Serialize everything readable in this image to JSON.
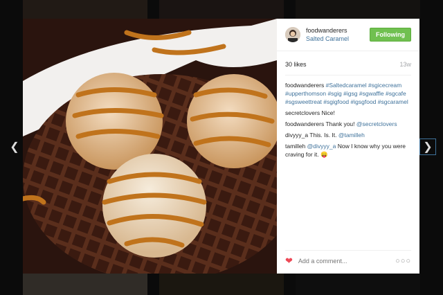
{
  "post": {
    "username": "foodwanderers",
    "location": "Salted Caramel",
    "follow_label": "Following",
    "likes": "30 likes",
    "age": "13w"
  },
  "comments": [
    {
      "user": "foodwanderers",
      "text_parts": [
        "#Saltedcaramel",
        "#sgicecream",
        "#upperthomson",
        "#sgig",
        "#igsg",
        "#sgwaffle",
        "#sgcafe",
        "#sgsweettreat",
        "#sgigfood",
        "#igsgfood",
        "#sgcaramel"
      ]
    },
    {
      "user": "secretclovers",
      "text": "Nice!"
    },
    {
      "user": "foodwanderers",
      "text": "Thank you!",
      "mention": "@secretclovers"
    },
    {
      "user": "divyyy_a",
      "text": "This. Is. It.",
      "mention": "@tamilleh"
    },
    {
      "user": "tamilleh",
      "mention": "@divyyy_a",
      "text": "Now I know why you were craving for it. 😛"
    }
  ],
  "footer": {
    "placeholder": "Add a comment...",
    "heart_icon": "heart-icon",
    "more_icon": "more-options-icon"
  },
  "colors": {
    "follow_green": "#70c050",
    "link_blue": "#3f729b",
    "heart_red": "#ed4956"
  }
}
